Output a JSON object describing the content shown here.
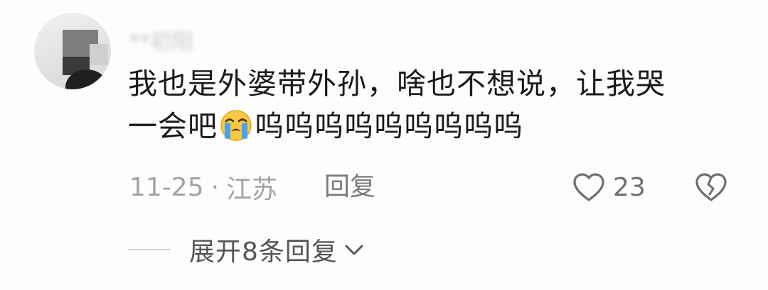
{
  "comment": {
    "username": "**初阳",
    "text_line1": "我也是外婆带外孙，啥也不想说，让我哭",
    "text_line2_before": "一会吧",
    "text_line2_emoji": "loudly-crying-face-icon",
    "text_line2_after": "呜呜呜呜呜呜呜呜呜",
    "date": "11-25",
    "separator": "·",
    "location": "江苏",
    "reply_label": "回复",
    "like_count": "23",
    "expand_label": "展开8条回复"
  },
  "colors": {
    "text_primary": "#1a1a1a",
    "text_meta": "#a3a3a3",
    "icon_gray": "#6e6e6e",
    "emoji_face": "#f7c843",
    "emoji_tear": "#4aa3f0",
    "background": "#fdfdfd"
  },
  "icons": {
    "like": "heart-outline-icon",
    "dislike": "broken-heart-icon",
    "expand": "chevron-down-icon"
  }
}
